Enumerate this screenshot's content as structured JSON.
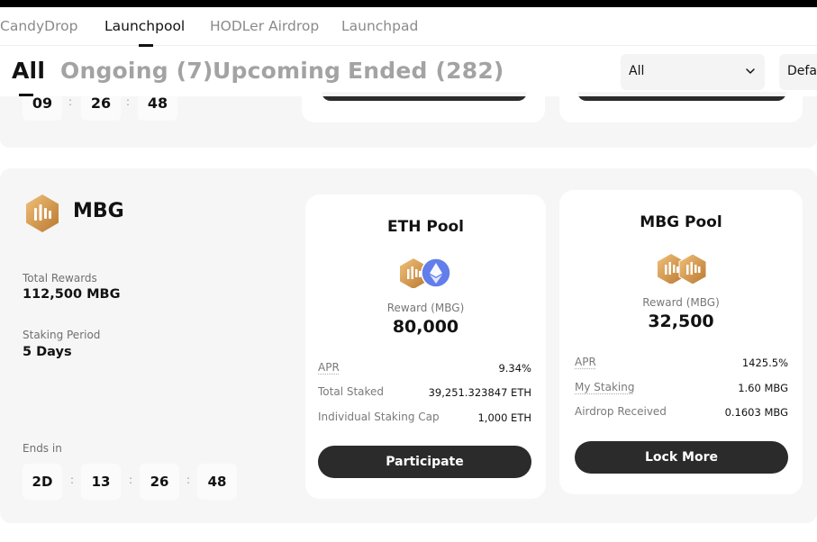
{
  "nav": {
    "items": [
      {
        "label": "CandyDrop"
      },
      {
        "label": "Launchpool"
      },
      {
        "label": "HODLer Airdrop"
      },
      {
        "label": "Launchpad"
      }
    ],
    "active": "Launchpool"
  },
  "filters": {
    "tabs": [
      {
        "label": "All"
      },
      {
        "label": "Ongoing (7)"
      },
      {
        "label": "Upcoming"
      },
      {
        "label": "Ended (282)"
      }
    ],
    "active": "All",
    "select_primary": "All",
    "select_secondary": "Defa"
  },
  "prev_countdown": [
    "09",
    "26",
    "48"
  ],
  "project": {
    "token": "MBG",
    "total_rewards_label": "Total Rewards",
    "total_rewards_value": "112,500 MBG",
    "staking_period_label": "Staking Period",
    "staking_period_value": "5 Days",
    "ends_in_label": "Ends in",
    "countdown": [
      "2D",
      "13",
      "26",
      "48"
    ],
    "countdown_separator": ":"
  },
  "pools": [
    {
      "title": "ETH Pool",
      "icons": [
        "mbg-coin-icon",
        "eth-coin-icon"
      ],
      "reward_label": "Reward (MBG)",
      "reward_value": "80,000",
      "rows": [
        {
          "label": "APR",
          "value": "9.34%"
        },
        {
          "label": "Total Staked",
          "value": "39,251.323847 ETH"
        },
        {
          "label": "Individual Staking Cap",
          "value": "1,000 ETH"
        }
      ],
      "button": "Participate"
    },
    {
      "title": "MBG Pool",
      "icons": [
        "mbg-coin-icon",
        "mbg-coin-icon"
      ],
      "reward_label": "Reward (MBG)",
      "reward_value": "32,500",
      "rows": [
        {
          "label": "APR",
          "value": "1425.5%"
        },
        {
          "label": "My Staking",
          "value": "1.60 MBG"
        },
        {
          "label": "Airdrop Received",
          "value": "0.1603 MBG"
        }
      ],
      "button": "Lock More"
    }
  ],
  "colors": {
    "accent_dark": "#2b2b2b",
    "section_bg": "#f6f6f6",
    "mbg_gold": "#d69a4a",
    "eth_blue": "#627eea"
  }
}
